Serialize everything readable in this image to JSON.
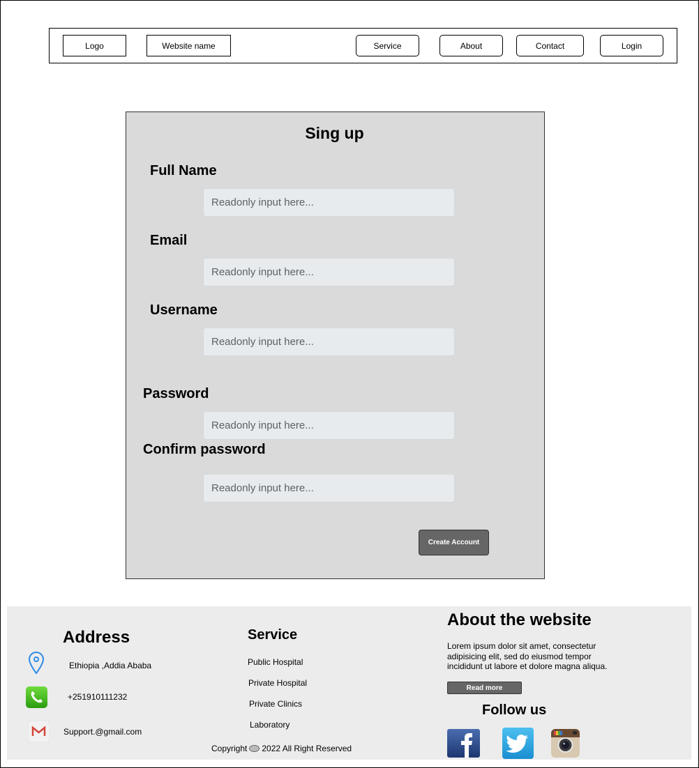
{
  "navbar": {
    "logo_label": "Logo",
    "site_name_label": "Website name",
    "service_label": "Service",
    "about_label": "About",
    "contact_label": "Contact",
    "login_label": "Login"
  },
  "signup": {
    "title": "Sing up",
    "fields": [
      {
        "label": "Full Name",
        "placeholder": "Readonly input here..."
      },
      {
        "label": "Email",
        "placeholder": "Readonly input here..."
      },
      {
        "label": "Username",
        "placeholder": "Readonly input here..."
      },
      {
        "label": "Password",
        "placeholder": "Readonly input here..."
      },
      {
        "label": "Confirm password",
        "placeholder": "Readonly input here..."
      }
    ],
    "submit_label": "Create Account"
  },
  "footer": {
    "address": {
      "heading": "Address",
      "location": "Ethiopia ,Addia Ababa",
      "phone": "+251910111232",
      "email": "Support.@gmail.com"
    },
    "service": {
      "heading": "Service",
      "items": [
        "Public Hospital",
        "Private Hospital",
        "Private Clinics",
        "Laboratory"
      ]
    },
    "about": {
      "heading": "About the website",
      "text": "Lorem ipsum dolor sit amet, consectetur adipisicing elit, sed do eiusmod tempor incididunt ut labore et dolore magna aliqua.",
      "read_more_label": "Read more"
    },
    "follow": {
      "heading": "Follow us",
      "icons": [
        "facebook-icon",
        "twitter-icon",
        "instagram-icon"
      ]
    },
    "copyright": {
      "prefix": "Copyright",
      "text": "2022 All Right Reserved"
    }
  },
  "colors": {
    "panel_bg": "#dadada",
    "footer_bg": "#ececec",
    "button_bg": "#666666",
    "input_bg": "#e8ebee",
    "facebook": "#2d4d8f",
    "twitter": "#29a9e1",
    "phone_green": "#3cb814",
    "gmail_red": "#d44638",
    "location_blue": "#2d8ae8"
  }
}
